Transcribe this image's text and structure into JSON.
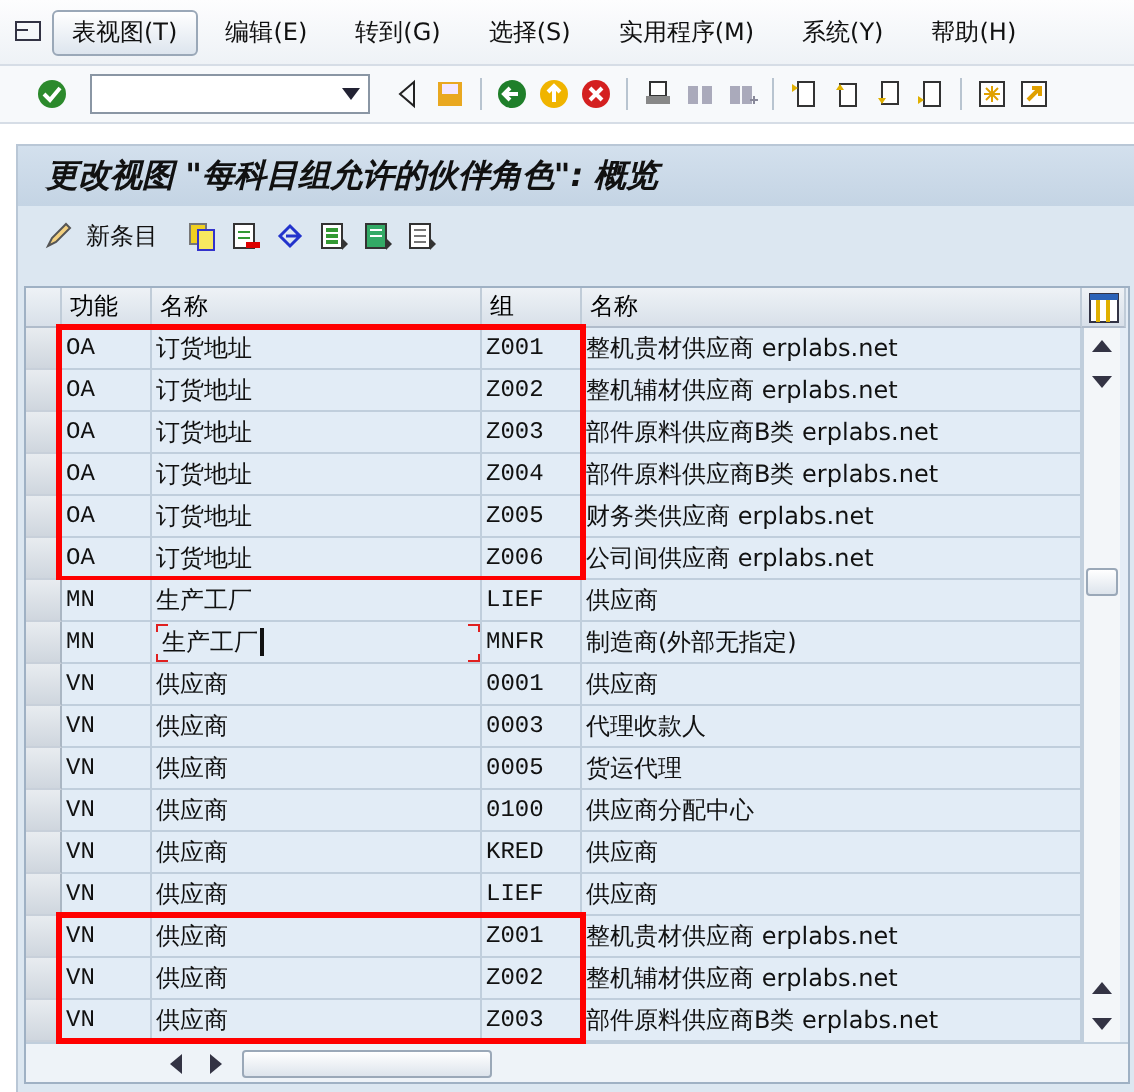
{
  "menu": [
    {
      "label": "表视图(T)",
      "selected": true
    },
    {
      "label": "编辑(E)",
      "selected": false
    },
    {
      "label": "转到(G)",
      "selected": false
    },
    {
      "label": "选择(S)",
      "selected": false
    },
    {
      "label": "实用程序(M)",
      "selected": false
    },
    {
      "label": "系统(Y)",
      "selected": false
    },
    {
      "label": "帮助(H)",
      "selected": false
    }
  ],
  "screen_title": "更改视图 \"每科目组允许的伙伴角色\": 概览",
  "app_toolbar": {
    "new_entries": "新条目"
  },
  "table": {
    "columns": [
      "功能",
      "名称",
      "组",
      "名称"
    ],
    "rows": [
      {
        "cells": [
          "OA",
          "订货地址",
          "Z001",
          "整机贵材供应商 erplabs.net"
        ],
        "highlighted": true,
        "focused": false
      },
      {
        "cells": [
          "OA",
          "订货地址",
          "Z002",
          "整机辅材供应商 erplabs.net"
        ],
        "highlighted": true,
        "focused": false
      },
      {
        "cells": [
          "OA",
          "订货地址",
          "Z003",
          "部件原料供应商B类 erplabs.net"
        ],
        "highlighted": true,
        "focused": false
      },
      {
        "cells": [
          "OA",
          "订货地址",
          "Z004",
          "部件原料供应商B类 erplabs.net"
        ],
        "highlighted": true,
        "focused": false
      },
      {
        "cells": [
          "OA",
          "订货地址",
          "Z005",
          "财务类供应商 erplabs.net"
        ],
        "highlighted": true,
        "focused": false
      },
      {
        "cells": [
          "OA",
          "订货地址",
          "Z006",
          "公司间供应商 erplabs.net"
        ],
        "highlighted": true,
        "focused": false
      },
      {
        "cells": [
          "MN",
          "生产工厂",
          "LIEF",
          "供应商"
        ],
        "highlighted": false,
        "focused": false
      },
      {
        "cells": [
          "MN",
          "生产工厂",
          "MNFR",
          "制造商(外部无指定)"
        ],
        "highlighted": false,
        "focused": true
      },
      {
        "cells": [
          "VN",
          "供应商",
          "0001",
          "供应商"
        ],
        "highlighted": false,
        "focused": false
      },
      {
        "cells": [
          "VN",
          "供应商",
          "0003",
          "代理收款人"
        ],
        "highlighted": false,
        "focused": false
      },
      {
        "cells": [
          "VN",
          "供应商",
          "0005",
          "货运代理"
        ],
        "highlighted": false,
        "focused": false
      },
      {
        "cells": [
          "VN",
          "供应商",
          "0100",
          "供应商分配中心"
        ],
        "highlighted": false,
        "focused": false
      },
      {
        "cells": [
          "VN",
          "供应商",
          "KRED",
          "供应商"
        ],
        "highlighted": false,
        "focused": false
      },
      {
        "cells": [
          "VN",
          "供应商",
          "LIEF",
          "供应商"
        ],
        "highlighted": false,
        "focused": false
      },
      {
        "cells": [
          "VN",
          "供应商",
          "Z001",
          "整机贵材供应商 erplabs.net"
        ],
        "highlighted": true,
        "focused": false
      },
      {
        "cells": [
          "VN",
          "供应商",
          "Z002",
          "整机辅材供应商 erplabs.net"
        ],
        "highlighted": true,
        "focused": false
      },
      {
        "cells": [
          "VN",
          "供应商",
          "Z003",
          "部件原料供应商B类 erplabs.net"
        ],
        "highlighted": true,
        "focused": false
      }
    ]
  }
}
